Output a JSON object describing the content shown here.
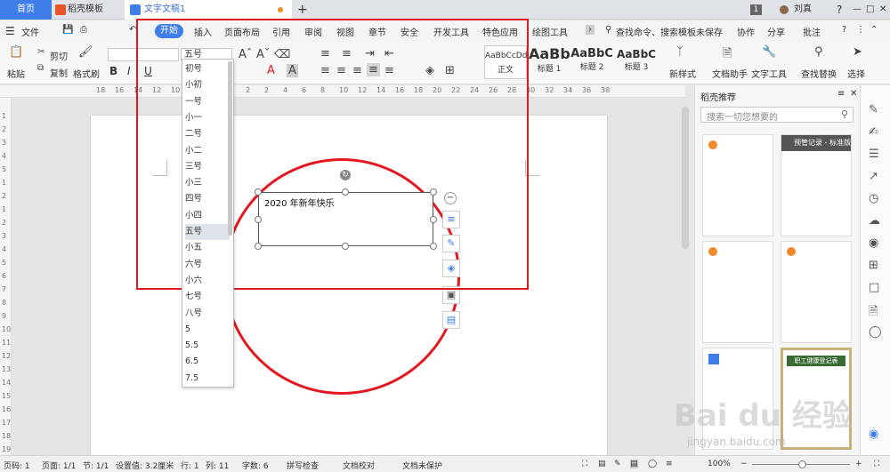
{
  "titlebar": {
    "tabs": [
      {
        "label": "首页"
      },
      {
        "label": "稻壳模板"
      },
      {
        "label": "文字文稿1"
      }
    ],
    "page_count": "1",
    "user": "刘真",
    "new_tab": "+",
    "help": "?"
  },
  "menu": {
    "file": "文件",
    "tabs": [
      "开始",
      "插入",
      "页面布局",
      "引用",
      "审阅",
      "视图",
      "章节",
      "安全",
      "开发工具",
      "特色应用",
      "绘图工具"
    ],
    "search": "查找命令、搜索模板",
    "unsaved": "未保存",
    "collab": "协作",
    "share": "分享",
    "annotate": "批注"
  },
  "toolbar": {
    "paste": "粘贴",
    "cut": "剪切",
    "copy": "复制",
    "format_painter": "格式刷",
    "font_size": "五号",
    "bold": "B",
    "italic": "I",
    "underline": "U",
    "styles": [
      {
        "preview": "AaBbCcDd",
        "label": "正文"
      },
      {
        "preview": "AaBb",
        "label": "标题 1"
      },
      {
        "preview": "AaBbC",
        "label": "标题 2"
      },
      {
        "preview": "AaBbC",
        "label": "标题 3"
      }
    ],
    "new_style": "新样式",
    "doc_helper": "文档助手",
    "text_tools": "文字工具",
    "find_replace": "查找替换",
    "select": "选择"
  },
  "ruler_numbers": [
    "18",
    "16",
    "14",
    "12",
    "10",
    "8",
    "6",
    "4",
    "2",
    "2",
    "4",
    "6",
    "8",
    "10",
    "12",
    "14",
    "16",
    "18",
    "20",
    "22",
    "24",
    "26",
    "28",
    "30",
    "32",
    "34",
    "36",
    "38"
  ],
  "vruler_numbers": [
    "1",
    "2",
    "3",
    "4",
    "5",
    "1",
    "2",
    "1",
    "2",
    "3",
    "4",
    "5",
    "6",
    "7",
    "8",
    "9",
    "10",
    "11",
    "12",
    "13",
    "14",
    "15",
    "16",
    "17",
    "18",
    "19"
  ],
  "font_sizes": [
    "初号",
    "小初",
    "一号",
    "小一",
    "二号",
    "小二",
    "三号",
    "小三",
    "四号",
    "小四",
    "五号",
    "小五",
    "六号",
    "小六",
    "七号",
    "八号",
    "5",
    "5.5",
    "6.5",
    "7.5"
  ],
  "selected_size": "五号",
  "document": {
    "textbox_text": "2020 年新年快乐"
  },
  "sidebar": {
    "title": "稻壳推荐",
    "search_placeholder": "搜索一切您想要的",
    "thumb_label": "预管记录 - 标准版",
    "thumb_label2": "职工健康登记表"
  },
  "statusbar": {
    "page_num": "页码: 1",
    "pages": "页面: 1/1",
    "section": "节: 1/1",
    "setting": "设置值: 3.2厘米",
    "row": "行: 1",
    "col": "列: 11",
    "words": "字数: 6",
    "spell": "拼写检查",
    "proof": "文档校对",
    "protect": "文档未保护",
    "zoom": "100%"
  },
  "watermark": {
    "main": "Bai du 经验",
    "sub": "jingyan.baidu.com"
  },
  "colors": {
    "accent": "#3f7ee8",
    "highlight": "#e3181f"
  }
}
